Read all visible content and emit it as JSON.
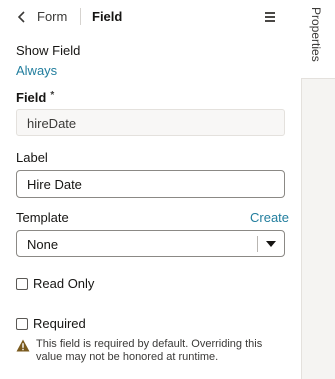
{
  "header": {
    "back_label": "Form",
    "title": "Field"
  },
  "rail": {
    "tab_label": "Properties"
  },
  "show_field": {
    "label": "Show Field",
    "value": "Always"
  },
  "field": {
    "label": "Field",
    "required_marker": "*",
    "value": "hireDate"
  },
  "label_field": {
    "label": "Label",
    "value": "Hire Date"
  },
  "template": {
    "label": "Template",
    "create_link": "Create",
    "selected": "None"
  },
  "read_only": {
    "label": "Read Only",
    "checked": false
  },
  "required": {
    "label": "Required",
    "checked": false
  },
  "warning": {
    "text": "This field is required by default. Overriding this value may not be honored at runtime."
  },
  "colors": {
    "link": "#227e9e",
    "warning": "#7a5a1e"
  }
}
